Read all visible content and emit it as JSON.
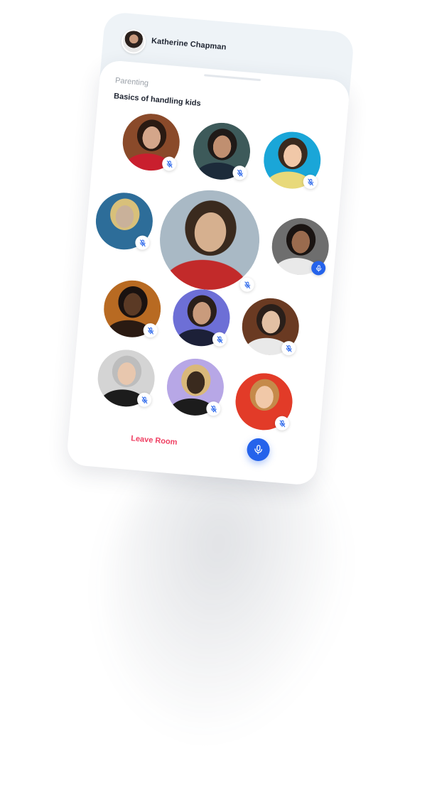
{
  "header": {
    "user_name": "Katherine Chapman"
  },
  "room": {
    "category": "Parenting",
    "title": "Basics of handling kids",
    "speaking_participant": "participant-6",
    "participants": [
      {
        "id": "participant-1",
        "muted": true,
        "bg": "#8a4a2a",
        "face": "#d4a68a",
        "hair": "#2a1a12",
        "body": "#c91f2e"
      },
      {
        "id": "participant-2",
        "muted": true,
        "bg": "#3d5a5a",
        "face": "#c08f70",
        "hair": "#1f1a18",
        "body": "#1c2b3a"
      },
      {
        "id": "participant-3",
        "muted": true,
        "bg": "#1aa6d8",
        "face": "#f1c8a8",
        "hair": "#3a2a1e",
        "body": "#e8d97a"
      },
      {
        "id": "participant-4",
        "muted": true,
        "bg": "#2d6d99",
        "face": "#c9b19a",
        "hair": "#d8c07a",
        "body": "#2d6d99"
      },
      {
        "id": "participant-5",
        "muted": true,
        "bg": "#a9b9c5",
        "face": "#d6b08f",
        "hair": "#3a2a1e",
        "body": "#c22a2a"
      },
      {
        "id": "participant-6",
        "muted": false,
        "bg": "#6e6e6e",
        "face": "#9a6b4e",
        "hair": "#1a1412",
        "body": "#e9e9e9"
      },
      {
        "id": "participant-7",
        "muted": true,
        "bg": "#b86a22",
        "face": "#5b3a25",
        "hair": "#1a1210",
        "body": "#2a1a12"
      },
      {
        "id": "participant-8",
        "muted": true,
        "bg": "#6d6fd6",
        "face": "#c99b7c",
        "hair": "#2a1f1a",
        "body": "#1c2038"
      },
      {
        "id": "participant-9",
        "muted": true,
        "bg": "#6a3a22",
        "face": "#e2c0a4",
        "hair": "#2a1f1a",
        "body": "#e9e9e9"
      },
      {
        "id": "participant-10",
        "muted": true,
        "bg": "#d4d4d4",
        "face": "#e8c7ae",
        "hair": "#bdbdbd",
        "body": "#1c1c1c"
      },
      {
        "id": "participant-11",
        "muted": true,
        "bg": "#b7a7e6",
        "face": "#3a2a1e",
        "hair": "#d9b87a",
        "body": "#1c1c1c"
      },
      {
        "id": "participant-12",
        "muted": true,
        "bg": "#e23b28",
        "face": "#f1c8a8",
        "hair": "#c58a4a",
        "body": "#e23b28"
      }
    ]
  },
  "actions": {
    "leave_label": "Leave Room"
  },
  "colors": {
    "accent": "#2563eb",
    "danger": "#ef3f62"
  }
}
